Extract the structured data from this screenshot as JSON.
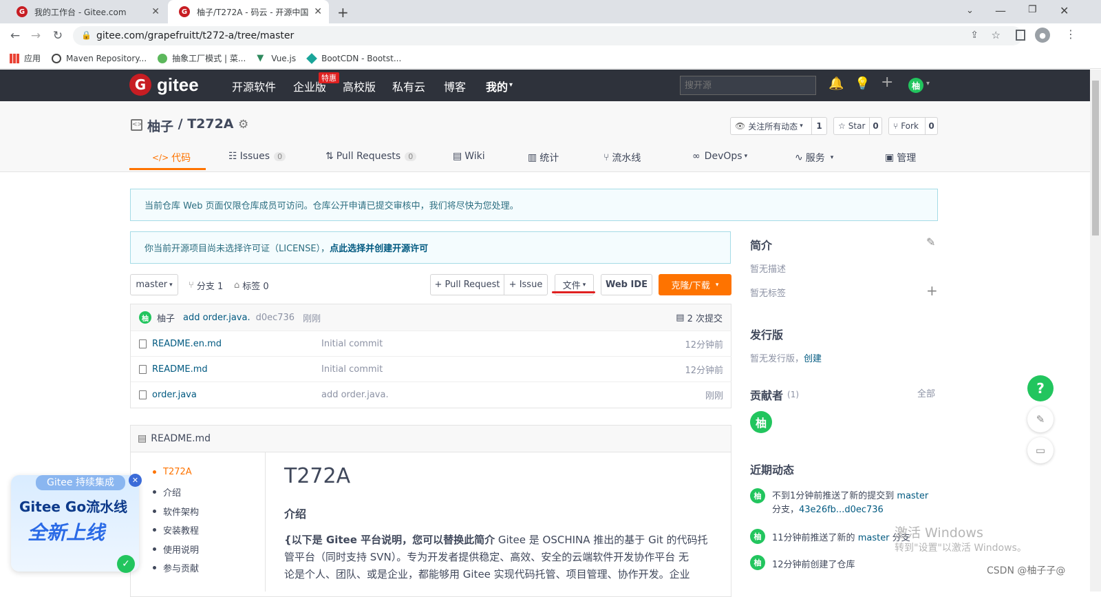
{
  "browser": {
    "tabs": [
      {
        "title": "我的工作台 - Gitee.com"
      },
      {
        "title": "柚子/T272A - 码云 - 开源中国"
      }
    ],
    "url": "gitee.com/grapefruitt/t272-a/tree/master",
    "bookmarks": [
      "应用",
      "Maven Repository...",
      "抽象工厂模式 | 菜...",
      "Vue.js",
      "BootCDN - Bootst..."
    ]
  },
  "gitee_header": {
    "logo": "gitee",
    "nav": [
      "开源软件",
      "企业版",
      "高校版",
      "私有云",
      "博客",
      "我的"
    ],
    "badge": "特惠",
    "search_placeholder": "搜开源",
    "user_avatar": "柚"
  },
  "repo": {
    "owner": "柚子",
    "separator": " / ",
    "name": "T272A",
    "watch_label": "关注所有动态",
    "watch_count": "1",
    "star_label": "Star",
    "star_count": "0",
    "fork_label": "Fork",
    "fork_count": "0",
    "tabs": [
      {
        "label": "代码"
      },
      {
        "label": "Issues",
        "count": "0"
      },
      {
        "label": "Pull Requests",
        "count": "0"
      },
      {
        "label": "Wiki"
      },
      {
        "label": "统计"
      },
      {
        "label": "流水线"
      },
      {
        "label": "DevOps"
      },
      {
        "label": "服务"
      },
      {
        "label": "管理"
      }
    ]
  },
  "notices": {
    "review": "当前仓库 Web 页面仅限仓库成员可访问。仓库公开申请已提交审核中，我们将尽快为您处理。",
    "license_text": "你当前开源项目尚未选择许可证（LICENSE），",
    "license_link": "点此选择并创建开源许可"
  },
  "toolbar": {
    "branch": "master",
    "branches": "分支 1",
    "tags": "标签 0",
    "pull_request": "+ Pull Request",
    "issue": "+ Issue",
    "file": "文件",
    "webide": "Web IDE",
    "clone": "克隆/下载"
  },
  "last_commit": {
    "author": "柚子",
    "message": "add order.java.",
    "hash": "d0ec736",
    "time": "刚刚",
    "commits": "2 次提交"
  },
  "files": [
    {
      "name": "README.en.md",
      "message": "Initial commit",
      "time": "12分钟前"
    },
    {
      "name": "README.md",
      "message": "Initial commit",
      "time": "12分钟前"
    },
    {
      "name": "order.java",
      "message": "add order.java.",
      "time": "刚刚"
    }
  ],
  "readme": {
    "header": "README.md",
    "toc": [
      "T272A",
      "介绍",
      "软件架构",
      "安装教程",
      "使用说明",
      "参与贡献"
    ],
    "title": "T272A",
    "section": "介绍",
    "body_bold": "{以下是 Gitee 平台说明，您可以替换此简介",
    "body_line1": " Gitee 是 OSCHINA 推出的基于 Git 的代码托",
    "body_line2": "管平台（同时支持 SVN）。专为开发者提供稳定、高效、安全的云端软件开发协作平台 无",
    "body_line3": "论是个人、团队、或是企业，都能够用 Gitee 实现代码托管、项目管理、协作开发。企业"
  },
  "sidebar": {
    "intro_title": "简介",
    "no_desc": "暂无描述",
    "no_tags": "暂无标签",
    "release_title": "发行版",
    "no_release": "暂无发行版，",
    "create": "创建",
    "contrib_title": "贡献者",
    "contrib_count": "(1)",
    "all": "全部",
    "contrib_avatar": "柚",
    "activity_title": "近期动态",
    "activities": [
      {
        "pre": "不到1分钟前推送了新的提交到 ",
        "link": "master",
        "line2_pre": "分支，",
        "line2_link": "43e26fb...d0ec736"
      },
      {
        "pre": "11分钟前推送了新的 ",
        "link": "master",
        "post": " 分支"
      },
      {
        "pre": "12分钟前创建了仓库"
      }
    ]
  },
  "promo": {
    "tag": "Gitee 持续集成",
    "line1": "Gitee Go流水线",
    "line2": "全新上线"
  },
  "watermark": {
    "line1": "激活 Windows",
    "line2": "转到\"设置\"以激活 Windows。",
    "csdn": "CSDN @柚子子@"
  },
  "float_help": "?",
  "colors": {
    "accent": "#fe7300",
    "header_bg": "#2e323b",
    "brand_red": "#c71d23",
    "green": "#22c55e"
  }
}
